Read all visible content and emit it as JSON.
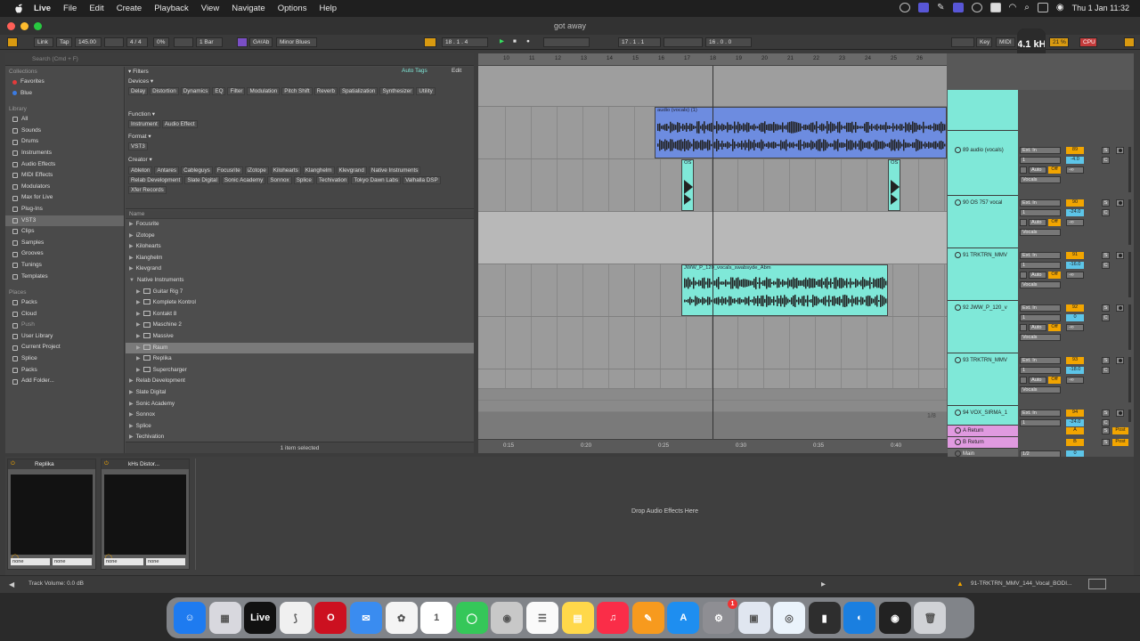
{
  "menubar": {
    "items": [
      "Live",
      "File",
      "Edit",
      "Create",
      "Playback",
      "View",
      "Navigate",
      "Options",
      "Help"
    ],
    "clock": "Thu 1 Jan  11:32"
  },
  "window": {
    "title": "got away"
  },
  "transport": {
    "link": "Link",
    "tap": "Tap",
    "tempo": "145.00",
    "signature": "4 / 4",
    "groove": "0%",
    "quantize": "1 Bar",
    "key": "G#/Ab",
    "scale": "Minor Blues",
    "position": "18 . 1 . 4",
    "loop_start": "17 . 1 . 1",
    "loop_length": "16 . 0 . 0",
    "key_btn": "Key",
    "midi_btn": "MIDI",
    "sample_rate": "44.1 kHz",
    "cpu_pct": "21 %",
    "cpu": "CPU"
  },
  "browser": {
    "search_placeholder": "Search (Cmd + F)",
    "collections_label": "Collections",
    "collections": [
      {
        "label": "Favorites",
        "color": "#e23b3b"
      },
      {
        "label": "Blue",
        "color": "#3b7be2"
      }
    ],
    "library_label": "Library",
    "library": [
      "All",
      "Sounds",
      "Drums",
      "Instruments",
      "Audio Effects",
      "MIDI Effects",
      "Modulators",
      "Max for Live",
      "Plug-Ins",
      "VST3",
      "Clips",
      "Samples",
      "Grooves",
      "Tunings",
      "Templates"
    ],
    "places_label": "Places",
    "places": [
      "Packs",
      "Cloud",
      "Push",
      "User Library",
      "Current Project",
      "Splice",
      "Packs",
      "Add Folder..."
    ],
    "filters_label": "Filters",
    "auto_tags": "Auto Tags",
    "edit": "Edit",
    "devices_label": "Devices",
    "devices": [
      "Delay",
      "Distortion",
      "Dynamics",
      "EQ",
      "Filter",
      "Modulation",
      "Pitch Shift",
      "Reverb",
      "Spatialization",
      "Synthesizer",
      "Utility"
    ],
    "function_label": "Function",
    "function": [
      "Instrument",
      "Audio Effect"
    ],
    "format_label": "Format",
    "format": [
      "VST3"
    ],
    "creator_label": "Creator",
    "creator": [
      "Ableton",
      "Antares",
      "Cableguys",
      "Focusrite",
      "iZotope",
      "Kilohearts",
      "Klanghelm",
      "Klevgrand",
      "Native Instruments",
      "Relab Development",
      "Slate Digital",
      "Sonic Academy",
      "Sonnox",
      "Splice",
      "Techivation",
      "Tokyo Dawn Labs",
      "Valhalla DSP",
      "Xfer Records"
    ],
    "name_header": "Name",
    "files": [
      {
        "label": "Focusrite",
        "indent": 0,
        "open": false
      },
      {
        "label": "iZotope",
        "indent": 0,
        "open": false
      },
      {
        "label": "Kilohearts",
        "indent": 0,
        "open": false
      },
      {
        "label": "Klanghelm",
        "indent": 0,
        "open": false
      },
      {
        "label": "Klevgrand",
        "indent": 0,
        "open": false
      },
      {
        "label": "Native Instruments",
        "indent": 0,
        "open": true
      },
      {
        "label": "Guitar Rig 7",
        "indent": 1,
        "plug": true
      },
      {
        "label": "Komplete Kontrol",
        "indent": 1,
        "plug": true
      },
      {
        "label": "Kontakt 8",
        "indent": 1,
        "plug": true
      },
      {
        "label": "Maschine 2",
        "indent": 1,
        "plug": true
      },
      {
        "label": "Massive",
        "indent": 1,
        "plug": true
      },
      {
        "label": "Raum",
        "indent": 1,
        "plug": true,
        "selected": true
      },
      {
        "label": "Replika",
        "indent": 1,
        "plug": true
      },
      {
        "label": "Supercharger",
        "indent": 1,
        "plug": true
      },
      {
        "label": "Relab Development",
        "indent": 0,
        "open": false
      },
      {
        "label": "Slate Digital",
        "indent": 0,
        "open": false
      },
      {
        "label": "Sonic Academy",
        "indent": 0,
        "open": false
      },
      {
        "label": "Sonnox",
        "indent": 0,
        "open": false
      },
      {
        "label": "Splice",
        "indent": 0,
        "open": false
      },
      {
        "label": "Techivation",
        "indent": 0,
        "open": false
      }
    ],
    "status": "1 item selected"
  },
  "arrangement": {
    "ruler": [
      "10",
      "11",
      "12",
      "13",
      "14",
      "15",
      "16",
      "17",
      "18",
      "19",
      "20",
      "21",
      "22",
      "23",
      "24",
      "25",
      "26"
    ],
    "time": [
      "0:15",
      "0:20",
      "0:25",
      "0:30",
      "0:35",
      "0:40"
    ],
    "zoom": "1/8",
    "clips": {
      "audio_vocals": "audio (vocals) (1)",
      "os1": "OS",
      "os2": "OS",
      "jww": "JWW_P_120_vocals_swabsyde_Abm"
    }
  },
  "tracks": [
    {
      "name": "89 audio (vocals)",
      "num": "89",
      "vol": "-4.0",
      "input": "Ext. In",
      "chan": "1",
      "monitor": "Vocals"
    },
    {
      "name": "90 OS 757 vocal",
      "num": "90",
      "vol": "-24.0",
      "input": "Ext. In",
      "chan": "1",
      "monitor": "Vocals"
    },
    {
      "name": "91 TRKTRN_MMV",
      "num": "91",
      "vol": "-16.0",
      "input": "Ext. In",
      "chan": "1",
      "monitor": "Vocals"
    },
    {
      "name": "92 JWW_P_120_v",
      "num": "92",
      "vol": "0",
      "input": "Ext. In",
      "chan": "1",
      "monitor": "Vocals"
    },
    {
      "name": "93 TRKTRN_MMV",
      "num": "93",
      "vol": "-18.0",
      "input": "Ext. In",
      "chan": "1",
      "monitor": "Vocals"
    },
    {
      "name": "94 VOX_SIRMA_1",
      "num": "94",
      "vol": "-24.0",
      "input": "Ext. In",
      "chan": "1",
      "monitor": "Vocals"
    }
  ],
  "returns": [
    {
      "name": "A Return",
      "letter": "A",
      "post": "Post"
    },
    {
      "name": "B Return",
      "letter": "B",
      "post": "Post"
    }
  ],
  "main": {
    "name": "Main",
    "out": "1/2",
    "vol": "0"
  },
  "mixer_labels": {
    "auto": "Auto",
    "off": "Off",
    "inf": "-∞",
    "s": "S",
    "c": "C"
  },
  "devices": [
    {
      "name": "Replika",
      "sel1": "none",
      "sel2": "none"
    },
    {
      "name": "kHs Distor...",
      "sel1": "none",
      "sel2": "none"
    }
  ],
  "detail": {
    "drop_hint": "Drop Audio Effects Here"
  },
  "statusbar": {
    "left": "Track Volume: 0.0 dB",
    "right": "91-TRKTRN_MMV_144_Vocal_BODI..."
  },
  "dock": [
    {
      "name": "Finder",
      "color": "#1e7bf0",
      "glyph": "☺"
    },
    {
      "name": "Launchpad",
      "color": "#d8d8de",
      "glyph": "▦"
    },
    {
      "name": "Live",
      "color": "#111111",
      "glyph": "Live"
    },
    {
      "name": "Splice",
      "color": "#f0f0f0",
      "glyph": "⟆"
    },
    {
      "name": "Opera",
      "color": "#cc1020",
      "glyph": "O"
    },
    {
      "name": "Mail",
      "color": "#3a8cf0",
      "glyph": "✉"
    },
    {
      "name": "Photos",
      "color": "#f4f4f4",
      "glyph": "✿"
    },
    {
      "name": "Calendar",
      "color": "#ffffff",
      "glyph": "1"
    },
    {
      "name": "Messages",
      "color": "#35c759",
      "glyph": "◯"
    },
    {
      "name": "Contacts",
      "color": "#c8c8c8",
      "glyph": "◉"
    },
    {
      "name": "Reminders",
      "color": "#fafafa",
      "glyph": "☰"
    },
    {
      "name": "Notes",
      "color": "#ffd84a",
      "glyph": "▤"
    },
    {
      "name": "Music",
      "color": "#fa2d48",
      "glyph": "♫"
    },
    {
      "name": "Pages",
      "color": "#f79a1e",
      "glyph": "✎"
    },
    {
      "name": "App Store",
      "color": "#1e8ef0",
      "glyph": "A"
    },
    {
      "name": "System Settings",
      "color": "#8e8e93",
      "glyph": "⚙",
      "badge": "1"
    },
    {
      "name": "Preview",
      "color": "#e0e6f0",
      "glyph": "▣"
    },
    {
      "name": "Safari",
      "color": "#eaf3fb",
      "glyph": "◎"
    },
    {
      "name": "Bandcamp",
      "color": "#2e2e2e",
      "glyph": "▮"
    },
    {
      "name": "TeamViewer",
      "color": "#1a7fe0",
      "glyph": "◐"
    },
    {
      "name": "OBS",
      "color": "#222222",
      "glyph": "◉"
    },
    {
      "name": "Trash",
      "color": "#d0d2d6",
      "glyph": "🗑"
    }
  ]
}
